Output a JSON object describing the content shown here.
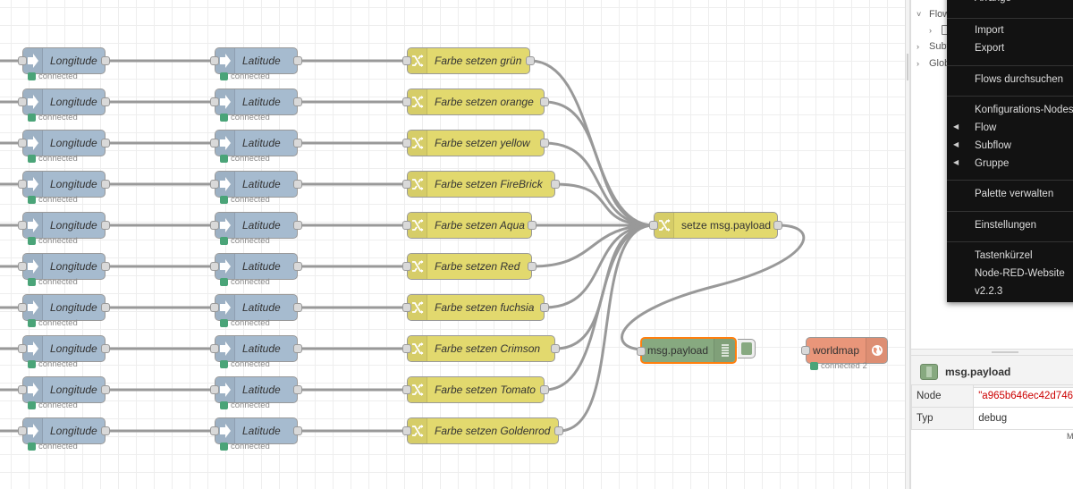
{
  "canvas": {
    "rows": [
      {
        "longitude": "Longitude",
        "latitude": "Latitude",
        "lon_status": "connected",
        "lat_status": "connected",
        "change": "Farbe setzen grün"
      },
      {
        "longitude": "Longitude",
        "latitude": "Latitude",
        "lon_status": "connected",
        "lat_status": "connected",
        "change": "Farbe setzen orange"
      },
      {
        "longitude": "Longitude",
        "latitude": "Latitude",
        "lon_status": "connected",
        "lat_status": "connected",
        "change": "Farbe setzen yellow"
      },
      {
        "longitude": "Longitude",
        "latitude": "Latitude",
        "lon_status": "connected",
        "lat_status": "connected",
        "change": "Farbe setzen FireBrick"
      },
      {
        "longitude": "Longitude",
        "latitude": "Latitude",
        "lon_status": "connected",
        "lat_status": "connected",
        "change": "Farbe setzen Aqua"
      },
      {
        "longitude": "Longitude",
        "latitude": "Latitude",
        "lon_status": "connected",
        "lat_status": "connected",
        "change": "Farbe setzen Red"
      },
      {
        "longitude": "Longitude",
        "latitude": "Latitude",
        "lon_status": "connected",
        "lat_status": "connected",
        "change": "Farbe setzen fuchsia"
      },
      {
        "longitude": "Longitude",
        "latitude": "Latitude",
        "lon_status": "connected",
        "lat_status": "connected",
        "change": "Farbe setzen Crimson"
      },
      {
        "longitude": "Longitude",
        "latitude": "Latitude",
        "lon_status": "connected",
        "lat_status": "connected",
        "change": "Farbe setzen Tomato"
      },
      {
        "longitude": "Longitude",
        "latitude": "Latitude",
        "lon_status": "connected",
        "lat_status": "connected",
        "change": "Farbe setzen Goldenrod"
      }
    ],
    "merge_node": "setze msg.payload",
    "debug_node": "msg.payload",
    "worldmap_node": "worldmap",
    "worldmap_status": "connected 2",
    "icons": {
      "input": "arrow-right-icon",
      "change": "shuffle-icon",
      "debug": "list-icon",
      "worldmap": "globe-icon"
    },
    "colors": {
      "input_node": "#a6bbcf",
      "change_node": "#e2d96e",
      "debug_node": "#87a980",
      "worldmap_node": "#e9967a",
      "status_connected": "#4aa478",
      "selected_outline": "#ff7f0e"
    }
  },
  "sidebar": {
    "tree": [
      {
        "label": "Flow",
        "chevron": "˅"
      },
      {
        "label": "",
        "chevron": "›"
      },
      {
        "label": "Subf",
        "chevron": "›"
      },
      {
        "label": "Glob",
        "chevron": "›"
      }
    ],
    "info": {
      "title": "msg.payload",
      "rows": [
        {
          "key": "Node",
          "value": "\"a965b646ec42d746"
        },
        {
          "key": "Typ",
          "value": "debug"
        }
      ],
      "more": "M"
    }
  },
  "menu": {
    "items": [
      {
        "label": "Arrange",
        "submenu": true
      },
      {
        "label": "Import",
        "submenu": false
      },
      {
        "label": "Export",
        "submenu": false
      },
      {
        "label": "Flows durchsuchen",
        "submenu": false
      },
      {
        "label": "Konfigurations-Nodes",
        "submenu": false
      },
      {
        "label": "Flow",
        "submenu": true
      },
      {
        "label": "Subflow",
        "submenu": true
      },
      {
        "label": "Gruppe",
        "submenu": true
      },
      {
        "label": "Palette verwalten",
        "submenu": false
      },
      {
        "label": "Einstellungen",
        "submenu": false
      },
      {
        "label": "Tastenkürzel",
        "submenu": false
      },
      {
        "label": "Node-RED-Website",
        "submenu": false
      },
      {
        "label": "v2.2.3",
        "submenu": false
      }
    ]
  }
}
